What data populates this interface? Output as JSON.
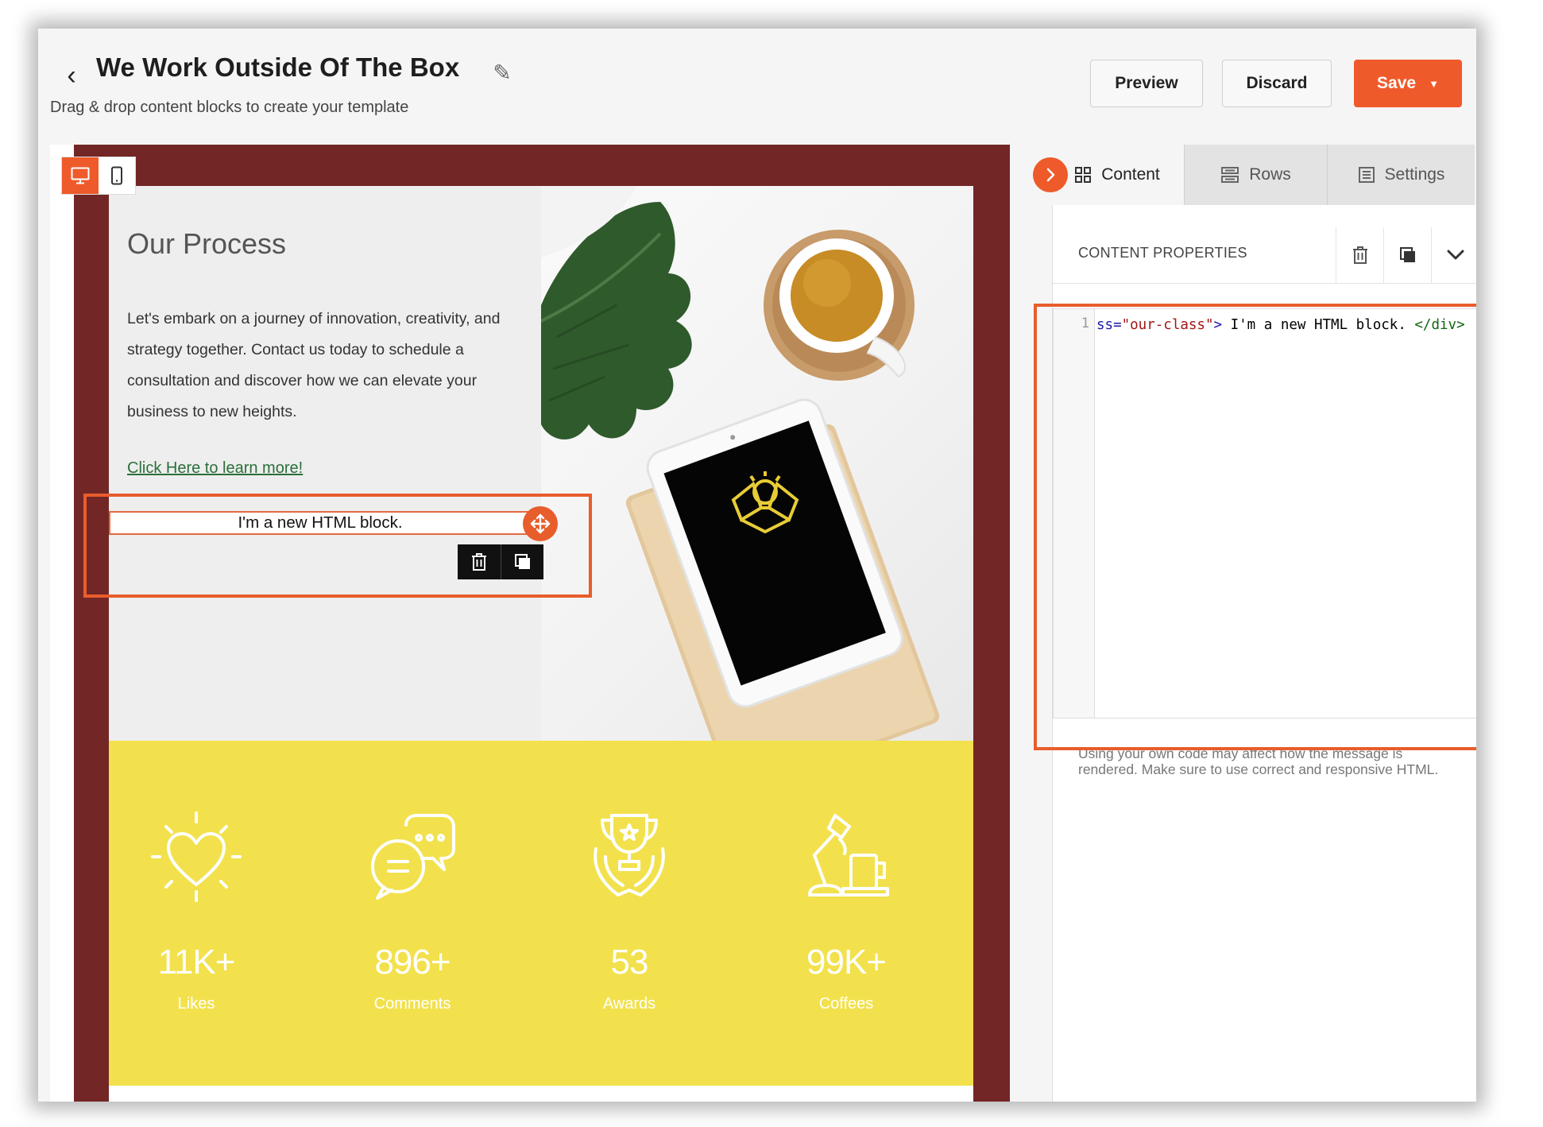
{
  "header": {
    "title": "We Work Outside Of The Box",
    "subtitle": "Drag & drop content blocks to create your template",
    "preview_label": "Preview",
    "discard_label": "Discard",
    "save_label": "Save"
  },
  "colors": {
    "accent": "#ef5a2b",
    "email_border": "#732626",
    "stats_background": "#f2e14c",
    "link": "#2b6f3a"
  },
  "canvas": {
    "view_modes": [
      "desktop-icon",
      "mobile-icon"
    ],
    "active_view": "desktop",
    "process": {
      "title": "Our Process",
      "body": "Let's embark on a journey of innovation, creativity, and strategy together. Contact us today to schedule a consultation and discover how we can elevate your business to new heights.",
      "link": "Click Here to learn more!"
    },
    "html_block": {
      "text": "I'm a new HTML block."
    },
    "stats": [
      {
        "icon": "heart-sun-icon",
        "value": "11K+",
        "label": "Likes"
      },
      {
        "icon": "chat-bubbles-icon",
        "value": "896+",
        "label": "Comments"
      },
      {
        "icon": "trophy-icon",
        "value": "53",
        "label": "Awards"
      },
      {
        "icon": "desk-lamp-icon",
        "value": "99K+",
        "label": "Coffees"
      }
    ]
  },
  "sidebar": {
    "tabs": [
      {
        "label": "Content",
        "icon": "grid-icon",
        "active": true
      },
      {
        "label": "Rows",
        "icon": "rows-icon",
        "active": false
      },
      {
        "label": "Settings",
        "icon": "settings-list-icon",
        "active": false
      }
    ],
    "panel_title": "CONTENT PROPERTIES",
    "editor": {
      "line_number": "1",
      "code_attr": "ss=",
      "code_string": "\"our-class\"",
      "code_gt": ">",
      "code_text": " I'm a new HTML block. ",
      "code_close": "</div>"
    },
    "help_text": "Using your own code may affect how the message is rendered. Make sure to use correct and responsive HTML."
  }
}
